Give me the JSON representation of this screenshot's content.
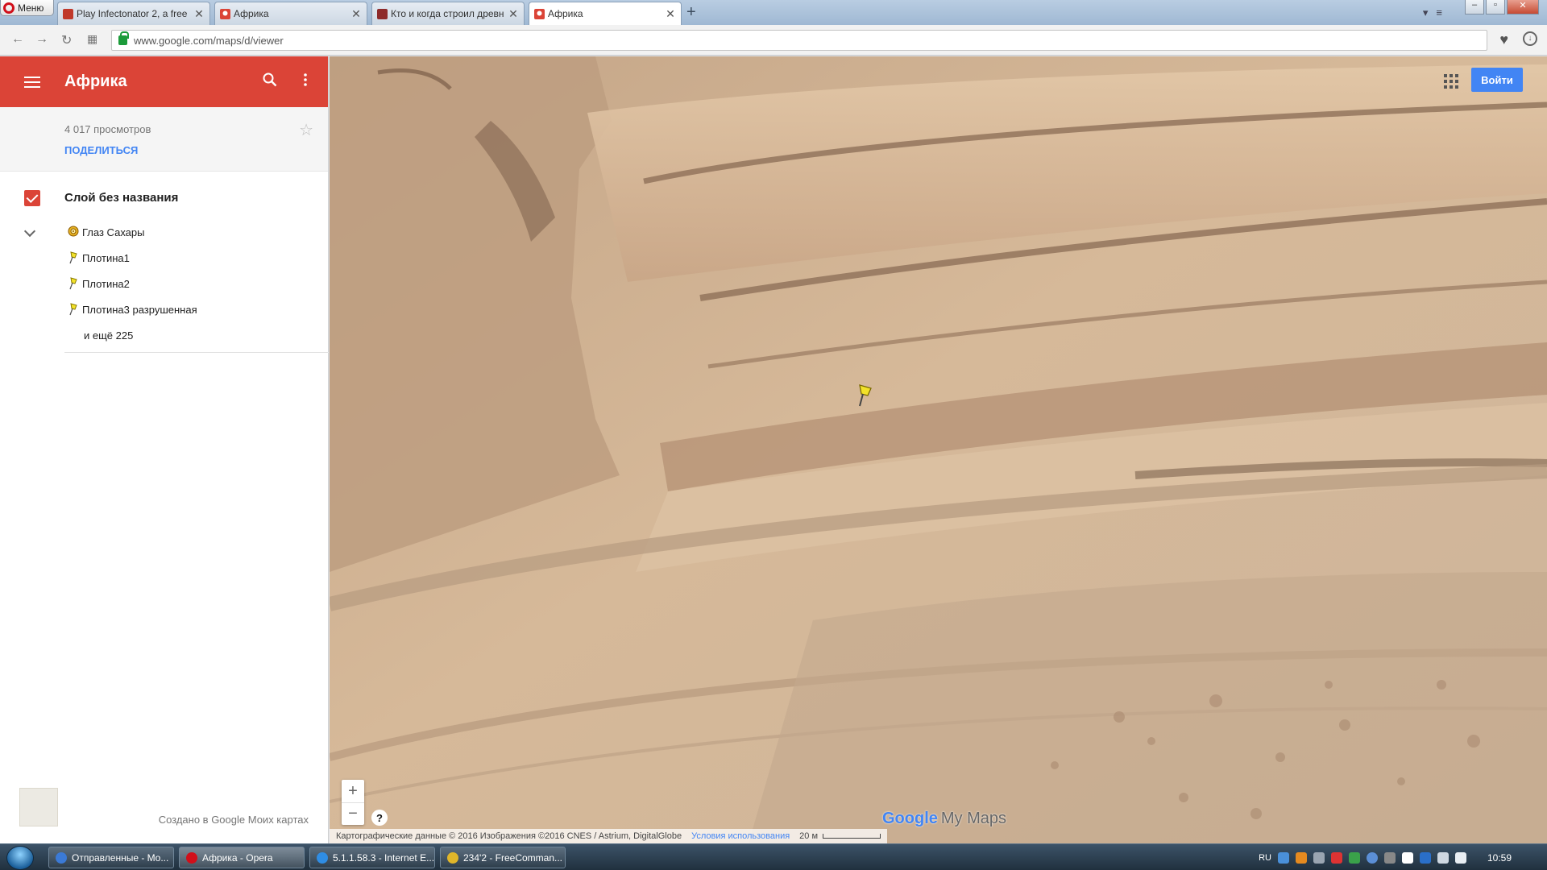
{
  "browser": {
    "menu_label": "Меню",
    "tabs": [
      {
        "title": "Play Infectonator 2, a free",
        "active": false
      },
      {
        "title": "Африка",
        "active": false
      },
      {
        "title": "Кто и когда строил древн",
        "active": false
      },
      {
        "title": "Африка",
        "active": true
      }
    ],
    "url": "www.google.com/maps/d/viewer"
  },
  "panel": {
    "title": "Африка",
    "views": "4 017 просмотров",
    "share": "ПОДЕЛИТЬСЯ",
    "layer_name": "Слой без названия",
    "items": [
      {
        "label": "Глаз Сахары",
        "icon": "target-icon"
      },
      {
        "label": "Плотина1",
        "icon": "pushpin-icon"
      },
      {
        "label": "Плотина2",
        "icon": "pushpin-icon"
      },
      {
        "label": "Плотина3 разрушенная",
        "icon": "pushpin-icon"
      }
    ],
    "more": "и ещё 225",
    "footer": "Создано в Google Моих картах"
  },
  "map": {
    "signin": "Войти",
    "attribution": "Картографические данные © 2016 Изображения ©2016 CNES / Astrium, DigitalGlobe",
    "terms": "Условия использования",
    "scale": "20 м",
    "logo_google": "Google",
    "logo_mymaps": "My Maps",
    "help": "?"
  },
  "taskbar": {
    "items": [
      {
        "label": "Отправленные - Mo...",
        "active": false
      },
      {
        "label": "Африка - Opera",
        "active": true
      },
      {
        "label": "5.1.1.58.3 - Internet E...",
        "active": false
      },
      {
        "label": "234'2 - FreeComman...",
        "active": false
      }
    ],
    "lang": "RU",
    "time": "10:59"
  },
  "colors": {
    "header_red": "#db4437",
    "link_blue": "#4285f4",
    "signin_blue": "#4285f4",
    "marker_yellow": "#f2e22a"
  }
}
